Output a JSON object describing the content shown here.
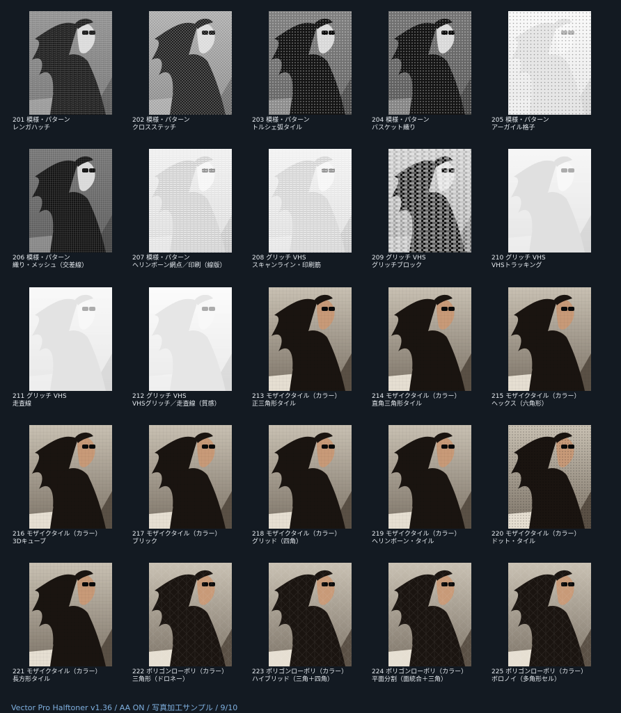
{
  "footer": "Vector Pro Halftoner v1.36 / AA ON / 写真加工サンプル / 9/10",
  "colors": {
    "background": "#131a22",
    "caption_text": "#e6ebf0",
    "footer_text": "#7fb0e0"
  },
  "samples": [
    {
      "number": "201",
      "category": "模様・パターン",
      "name": "レンガハッチ",
      "tone": "gray",
      "pattern": "hatch",
      "lightness": 0.55
    },
    {
      "number": "202",
      "category": "模様・パターン",
      "name": "クロスステッチ",
      "tone": "gray",
      "pattern": "cross",
      "lightness": 0.65
    },
    {
      "number": "203",
      "category": "模様・パターン",
      "name": "トルシェ弧タイル",
      "tone": "gray",
      "pattern": "dots",
      "lightness": 0.5
    },
    {
      "number": "204",
      "category": "模様・パターン",
      "name": "バスケット織り",
      "tone": "gray",
      "pattern": "dots",
      "lightness": 0.45
    },
    {
      "number": "205",
      "category": "模様・パターン",
      "name": "アーガイル格子",
      "tone": "gray",
      "pattern": "sparse",
      "lightness": 0.92
    },
    {
      "number": "206",
      "category": "模様・パターン",
      "name": "織り・メッシュ（交差線）",
      "tone": "gray",
      "pattern": "mesh",
      "lightness": 0.45
    },
    {
      "number": "207",
      "category": "模様・パターン",
      "name": "ヘリンボーン網点／印刷（線版）",
      "tone": "gray",
      "pattern": "lines",
      "lightness": 0.85
    },
    {
      "number": "208",
      "category": "グリッチ VHS",
      "name": "スキャンライン・印刷筋",
      "tone": "gray",
      "pattern": "lines",
      "lightness": 0.88
    },
    {
      "number": "209",
      "category": "グリッチ VHS",
      "name": "グリッチブロック",
      "tone": "gray",
      "pattern": "blocks",
      "lightness": 0.75
    },
    {
      "number": "210",
      "category": "グリッチ VHS",
      "name": "VHSトラッキング",
      "tone": "gray",
      "pattern": "scan",
      "lightness": 0.9
    },
    {
      "number": "211",
      "category": "グリッチ VHS",
      "name": "走査線",
      "tone": "gray",
      "pattern": "scan",
      "lightness": 0.93
    },
    {
      "number": "212",
      "category": "グリッチ VHS",
      "name": "VHSグリッチ／走査線（質感）",
      "tone": "gray",
      "pattern": "scan",
      "lightness": 0.96
    },
    {
      "number": "213",
      "category": "モザイクタイル（カラー）",
      "name": "正三角形タイル",
      "tone": "color",
      "pattern": "mosaic",
      "lightness": 0.6
    },
    {
      "number": "214",
      "category": "モザイクタイル（カラー）",
      "name": "直角三角形タイル",
      "tone": "color",
      "pattern": "mosaic",
      "lightness": 0.6
    },
    {
      "number": "215",
      "category": "モザイクタイル（カラー）",
      "name": "ヘックス（六角形）",
      "tone": "color",
      "pattern": "mosaic",
      "lightness": 0.6
    },
    {
      "number": "216",
      "category": "モザイクタイル（カラー）",
      "name": "3Dキューブ",
      "tone": "color",
      "pattern": "mosaic",
      "lightness": 0.6
    },
    {
      "number": "217",
      "category": "モザイクタイル（カラー）",
      "name": "ブリック",
      "tone": "color",
      "pattern": "mosaic",
      "lightness": 0.6
    },
    {
      "number": "218",
      "category": "モザイクタイル（カラー）",
      "name": "グリッド（四角）",
      "tone": "color",
      "pattern": "mosaic",
      "lightness": 0.6
    },
    {
      "number": "219",
      "category": "モザイクタイル（カラー）",
      "name": "ヘリンボーン・タイル",
      "tone": "color",
      "pattern": "mosaic",
      "lightness": 0.6
    },
    {
      "number": "220",
      "category": "モザイクタイル（カラー）",
      "name": "ドット・タイル",
      "tone": "color",
      "pattern": "dots",
      "lightness": 0.85
    },
    {
      "number": "221",
      "category": "モザイクタイル（カラー）",
      "name": "長方形タイル",
      "tone": "color",
      "pattern": "mosaic",
      "lightness": 0.6
    },
    {
      "number": "222",
      "category": "ポリゴンローポリ（カラー）",
      "name": "三角形（ドロネー）",
      "tone": "color",
      "pattern": "poly",
      "lightness": 0.55
    },
    {
      "number": "223",
      "category": "ポリゴンローポリ（カラー）",
      "name": "ハイブリッド（三角＋四角）",
      "tone": "color",
      "pattern": "poly",
      "lightness": 0.55
    },
    {
      "number": "224",
      "category": "ポリゴンローポリ（カラー）",
      "name": "平面分割（面統合＋三角）",
      "tone": "color",
      "pattern": "poly",
      "lightness": 0.55
    },
    {
      "number": "225",
      "category": "ポリゴンローポリ（カラー）",
      "name": "ボロノイ（多角形セル）",
      "tone": "color",
      "pattern": "poly",
      "lightness": 0.55
    }
  ]
}
